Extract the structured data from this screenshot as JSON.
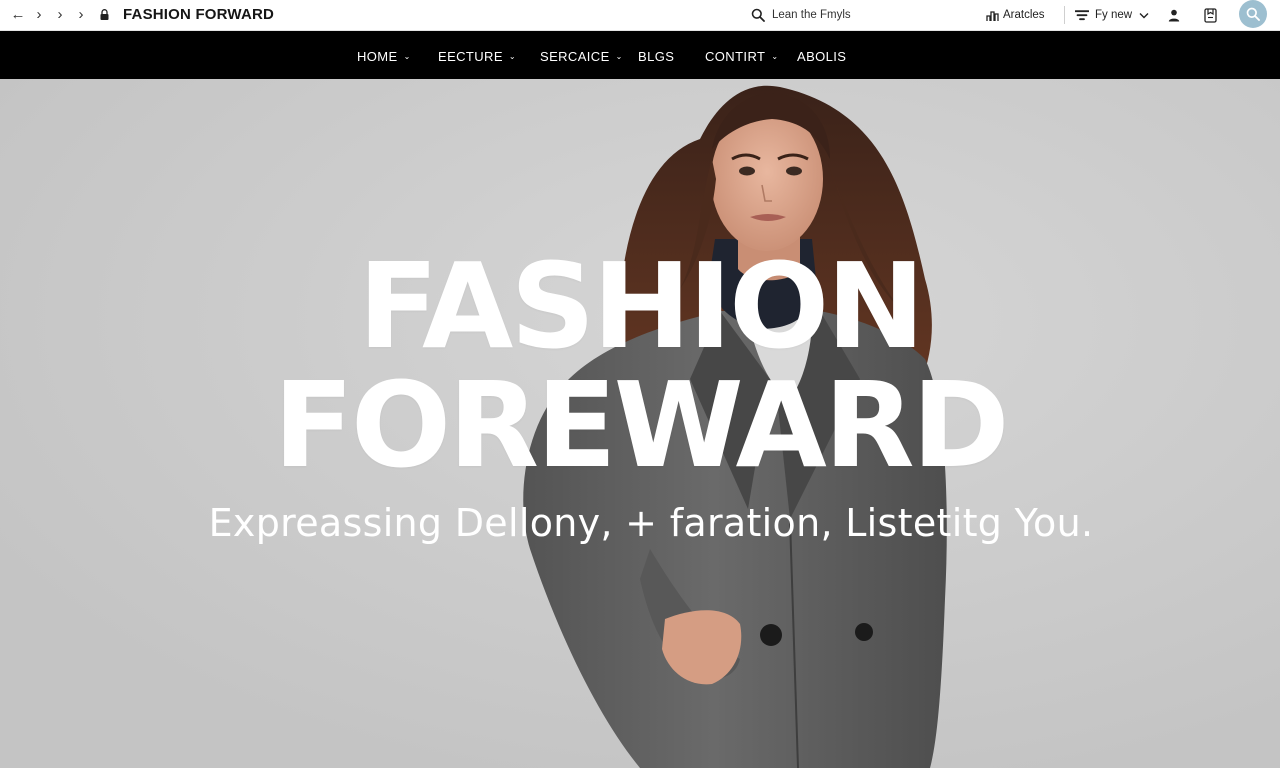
{
  "browser": {
    "site_title": "FASHION FORWARD",
    "search": {
      "placeholder": "Lean the Fmyls"
    },
    "articles_label": "Aratcles",
    "filter_label": "Fy new",
    "icons": [
      "back-arrow-icon",
      "forward-arrow-icon",
      "lock-icon",
      "search-icon",
      "articles-icon",
      "filter-icon",
      "user-icon",
      "bookmark-icon"
    ]
  },
  "nav": {
    "items": [
      {
        "label": "HOME",
        "has_dropdown": true
      },
      {
        "label": "EECTURE",
        "has_dropdown": true
      },
      {
        "label": "SERCAICE",
        "has_dropdown": true
      },
      {
        "label": "BLGS",
        "has_dropdown": false
      },
      {
        "label": "CONTIRT",
        "has_dropdown": true
      },
      {
        "label": "ABOLIS",
        "has_dropdown": false
      }
    ]
  },
  "hero": {
    "title_line1": "FASHION",
    "title_line2": "FOREWARD",
    "tagline": "Expreassing Dellony, + faration, Listetitg You."
  },
  "colors": {
    "nav_background": "#000000",
    "hero_background": "#c9c9c9",
    "accent_avatar": "#9dbfd0",
    "coat": "#5f5f5f",
    "text_on_dark": "#ffffff"
  }
}
